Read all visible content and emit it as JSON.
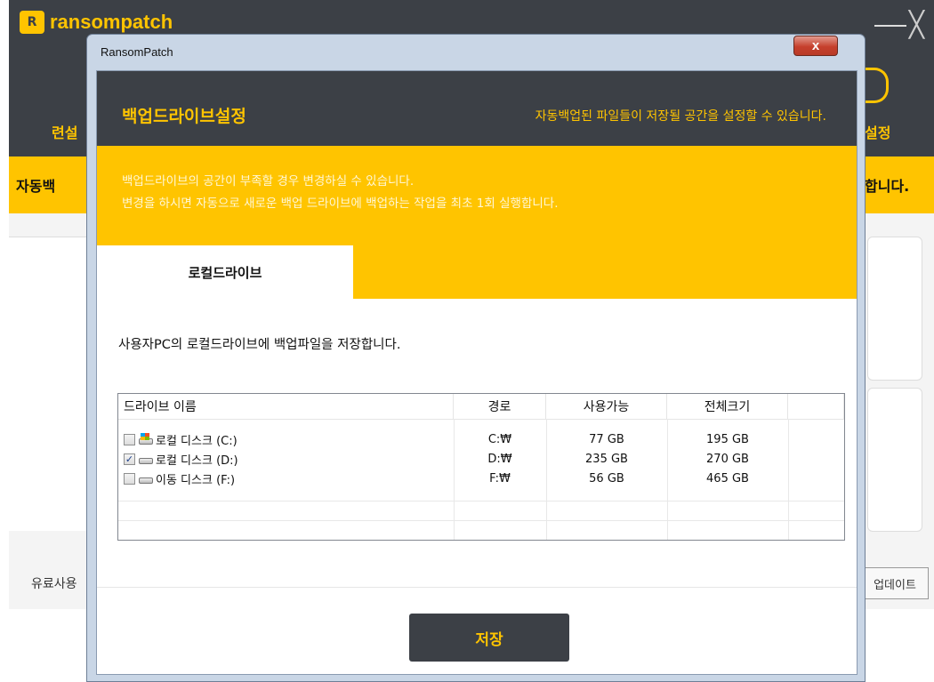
{
  "background": {
    "logo_text": "ransompatch",
    "nav_left_label": "련설",
    "nav_right_label": "설정",
    "yellow_left_text": "자동백",
    "yellow_right_text": "합니다.",
    "footer_left_text": "유료사용",
    "update_button_label": "업데이트"
  },
  "dialog": {
    "window_title": "RansomPatch",
    "close_glyph": "x",
    "header_title": "백업드라이브설정",
    "header_subtitle": "자동백업된 파일들이 저장될 공간을 설정할 수 있습니다.",
    "info_line1": "백업드라이브의 공간이 부족할 경우 변경하실 수 있습니다.",
    "info_line2": "변경을 하시면 자동으로 새로운 백업 드라이브에 백업하는 작업을 최초 1회 실행합니다.",
    "tab_label": "로컬드라이브",
    "description": "사용자PC의 로컬드라이브에 백업파일을 저장합니다.",
    "table": {
      "headers": [
        "드라이브 이름",
        "경로",
        "사용가능",
        "전체크기"
      ],
      "rows": [
        {
          "name": "로컬 디스크 (C:)",
          "path": "C:₩",
          "available": "77 GB",
          "total": "195 GB",
          "checked": false,
          "icon": "windows-drive-icon"
        },
        {
          "name": "로컬 디스크 (D:)",
          "path": "D:₩",
          "available": "235 GB",
          "total": "270 GB",
          "checked": true,
          "icon": "hard-drive-icon"
        },
        {
          "name": "이동 디스크 (F:)",
          "path": "F:₩",
          "available": "56 GB",
          "total": "465 GB",
          "checked": false,
          "icon": "hard-drive-icon"
        }
      ]
    },
    "save_label": "저장"
  },
  "colors": {
    "accent_yellow": "#ffc400",
    "header_dark": "#3c4046"
  }
}
